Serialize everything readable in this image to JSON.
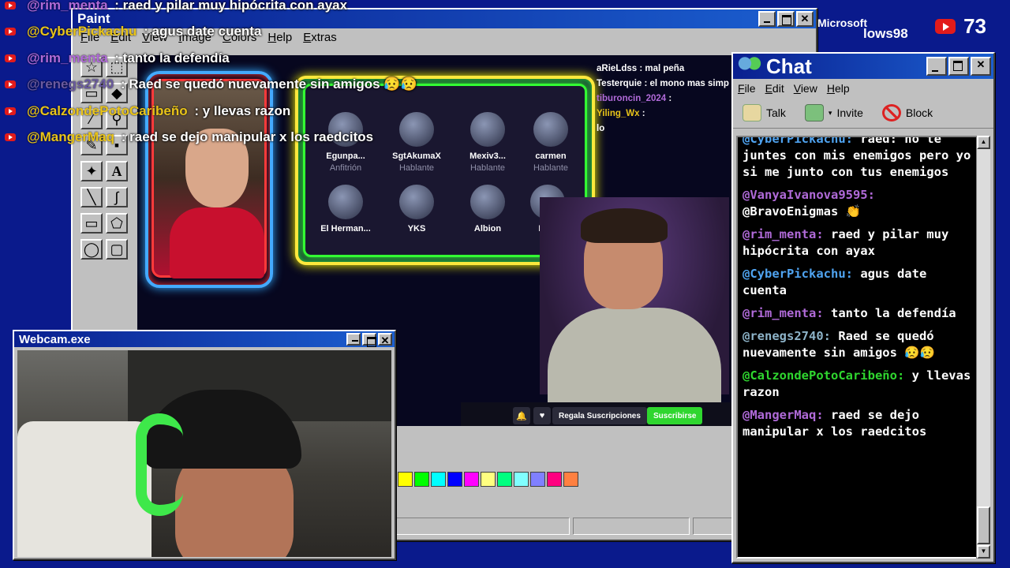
{
  "overlay_chat": [
    {
      "user": "@rim_menta",
      "sep": " : ",
      "text": "raed y pilar muy hipócrita con ayax",
      "color": "#b06ad8"
    },
    {
      "user": "@CyberPickachu",
      "sep": " : ",
      "text": "agus date cuenta",
      "color": "#e9c419"
    },
    {
      "user": "@rim_menta",
      "sep": " : ",
      "text": "tanto la defendía",
      "color": "#b06ad8"
    },
    {
      "user": "@renegs2740",
      "sep": " : ",
      "text": "Raed se quedó nuevamente sin amigos 😥😥",
      "color": "#6a5aa0"
    },
    {
      "user": "@CalzondePotoCaribeño",
      "sep": " : ",
      "text": "y llevas razon",
      "color": "#e9c419"
    },
    {
      "user": "@MangerMaq",
      "sep": " : ",
      "text": "raed se dejo manipular x los raedcitos",
      "color": "#e9c419"
    }
  ],
  "viewers": {
    "count": "73"
  },
  "ms_logo": {
    "top": "Microsoft",
    "bottom": "lows98"
  },
  "paint": {
    "title": "Paint",
    "menu": [
      "File",
      "Edit",
      "View",
      "Image",
      "Colors",
      "Help",
      "Extras"
    ],
    "palette": [
      "#ffff00",
      "#00ff00",
      "#00ffff",
      "#0000ff",
      "#ff00ff",
      "#ffff80",
      "#00ff80",
      "#80ffff",
      "#8080ff",
      "#ff0080",
      "#ff8040"
    ]
  },
  "stream": {
    "speakers": [
      {
        "name": "Egunpa...",
        "role": "Anfitrión"
      },
      {
        "name": "SgtAkumaX",
        "role": "Hablante"
      },
      {
        "name": "Mexiv3...",
        "role": "Hablante"
      },
      {
        "name": "carmen",
        "role": "Hablante"
      },
      {
        "name": "El Herman...",
        "role": ""
      },
      {
        "name": "YKS",
        "role": ""
      },
      {
        "name": "Albion",
        "role": ""
      },
      {
        "name": "Rela",
        "role": ""
      }
    ],
    "side_chat": [
      {
        "user": "aRieLdss",
        "text": ": mal peña"
      },
      {
        "user": "Testerquie",
        "text": ": el mono mas simp"
      },
      {
        "user": "tiburoncin_2024",
        "text": ":"
      },
      {
        "user": "Yiling_Wx",
        "text": ":"
      },
      {
        "user": "",
        "text": "lo"
      }
    ],
    "gift_label": "Regala Suscripciones",
    "subscribe_label": "Suscribirse"
  },
  "webcam": {
    "title": "Webcam.exe"
  },
  "chat": {
    "title": "Chat",
    "menu": [
      "File",
      "Edit",
      "View",
      "Help"
    ],
    "toolbar": {
      "talk": "Talk",
      "invite": "Invite",
      "block": "Block"
    },
    "messages": [
      {
        "user": "@CyberPickachu:",
        "text": "raed: no te juntes con mis enemigos pero yo si me junto con tus enemigos",
        "color": "#4fa3f0"
      },
      {
        "user": "@VanyaIvanova9595:",
        "text": "@BravoEnigmas 👏",
        "color": "#b06ad8"
      },
      {
        "user": "@rim_menta:",
        "text": "raed y pilar muy hipócrita con ayax",
        "color": "#b06ad8"
      },
      {
        "user": "@CyberPickachu:",
        "text": "agus date cuenta",
        "color": "#4fa3f0"
      },
      {
        "user": "@rim_menta:",
        "text": "tanto la defendía",
        "color": "#b06ad8"
      },
      {
        "user": "@renegs2740:",
        "text": "Raed se quedó nuevamente sin amigos 😥😥",
        "color": "#8db3c8"
      },
      {
        "user": "@CalzondePotoCaribeño:",
        "text": "y llevas razon",
        "color": "#2fd62f"
      },
      {
        "user": "@MangerMaq:",
        "text": "raed se dejo manipular x los raedcitos",
        "color": "#b06ad8"
      }
    ]
  }
}
